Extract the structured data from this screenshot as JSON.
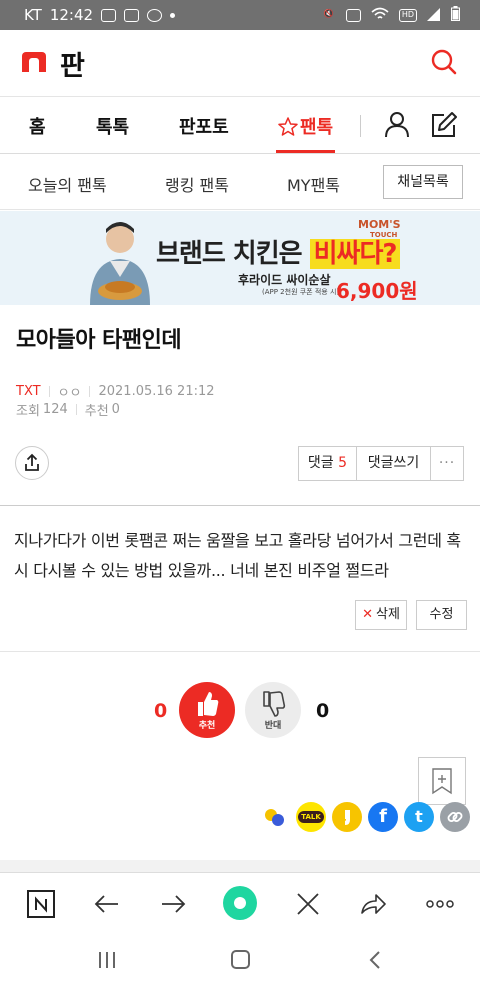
{
  "status_bar": {
    "carrier": "KT",
    "time": "12:42"
  },
  "header": {
    "logo_text": "판"
  },
  "top_nav": {
    "items": [
      {
        "label": "홈"
      },
      {
        "label": "톡톡"
      },
      {
        "label": "판포토"
      },
      {
        "label": "팬톡",
        "active": true
      }
    ]
  },
  "sub_nav": {
    "items": [
      {
        "label": "오늘의 팬톡"
      },
      {
        "label": "랭킹 팬톡"
      },
      {
        "label": "MY팬톡"
      }
    ],
    "channel_button": "채널목록"
  },
  "banner": {
    "headline_prefix": "브랜드 치킨은 ",
    "headline_highlight": "비싸다?",
    "brand_line1": "MOM'S",
    "brand_line2": "TOUCH",
    "sub_text": "후라이드 싸이순살",
    "sub_note": "(APP 2천원 쿠폰 적용 시)",
    "price": "6,900원"
  },
  "post": {
    "title": "모아들아 타팬인데",
    "category": "TXT",
    "author": "ㅇㅇ",
    "datetime": "2021.05.16 21:12",
    "views_label": "조회",
    "views": "124",
    "recommend_label": "추천",
    "recommend": "0",
    "body": "지나가다가 이번 롯팸콘 쩌는 움짤을 보고 홀라당 넘어가서 그런데 혹시 다시볼 수 있는 방법 있을까... 너네 본진 비주얼 쩔드라"
  },
  "actions": {
    "comment_label": "댓글",
    "comment_count": "5",
    "write_comment": "댓글쓰기",
    "more": "···",
    "delete": "삭제",
    "delete_mark": "✕",
    "edit": "수정"
  },
  "votes": {
    "up_count": "0",
    "up_label": "추천",
    "down_count": "0",
    "down_label": "반대"
  },
  "share": {
    "kakao_talk_label": "TALK",
    "facebook_label": "f",
    "twitter_label": "t"
  },
  "colors": {
    "accent": "#ec2b24",
    "status_bar": "#707070"
  }
}
